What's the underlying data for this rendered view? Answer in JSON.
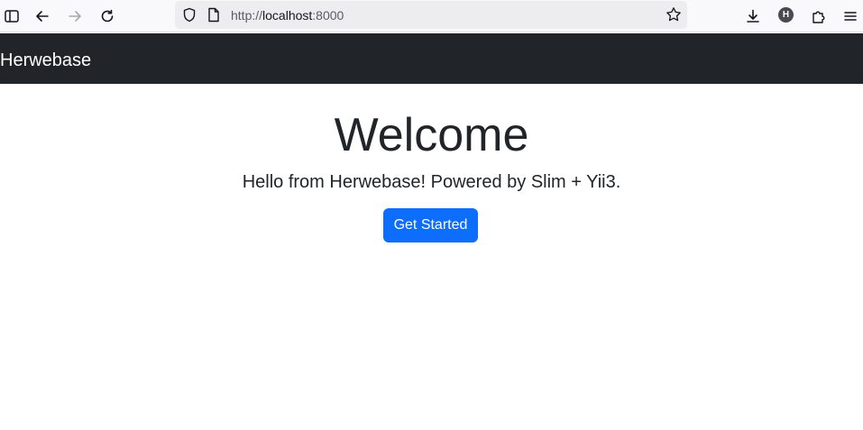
{
  "browser": {
    "url_scheme": "http://",
    "url_host": "localhost",
    "url_port": ":8000",
    "profile_initial": "H"
  },
  "navbar": {
    "brand": "Herwebase"
  },
  "hero": {
    "title": "Welcome",
    "lead": "Hello from Herwebase! Powered by Slim + Yii3.",
    "cta_label": "Get Started"
  },
  "colors": {
    "navbar_bg": "#212529",
    "primary": "#0d6efd",
    "text": "#212529"
  }
}
